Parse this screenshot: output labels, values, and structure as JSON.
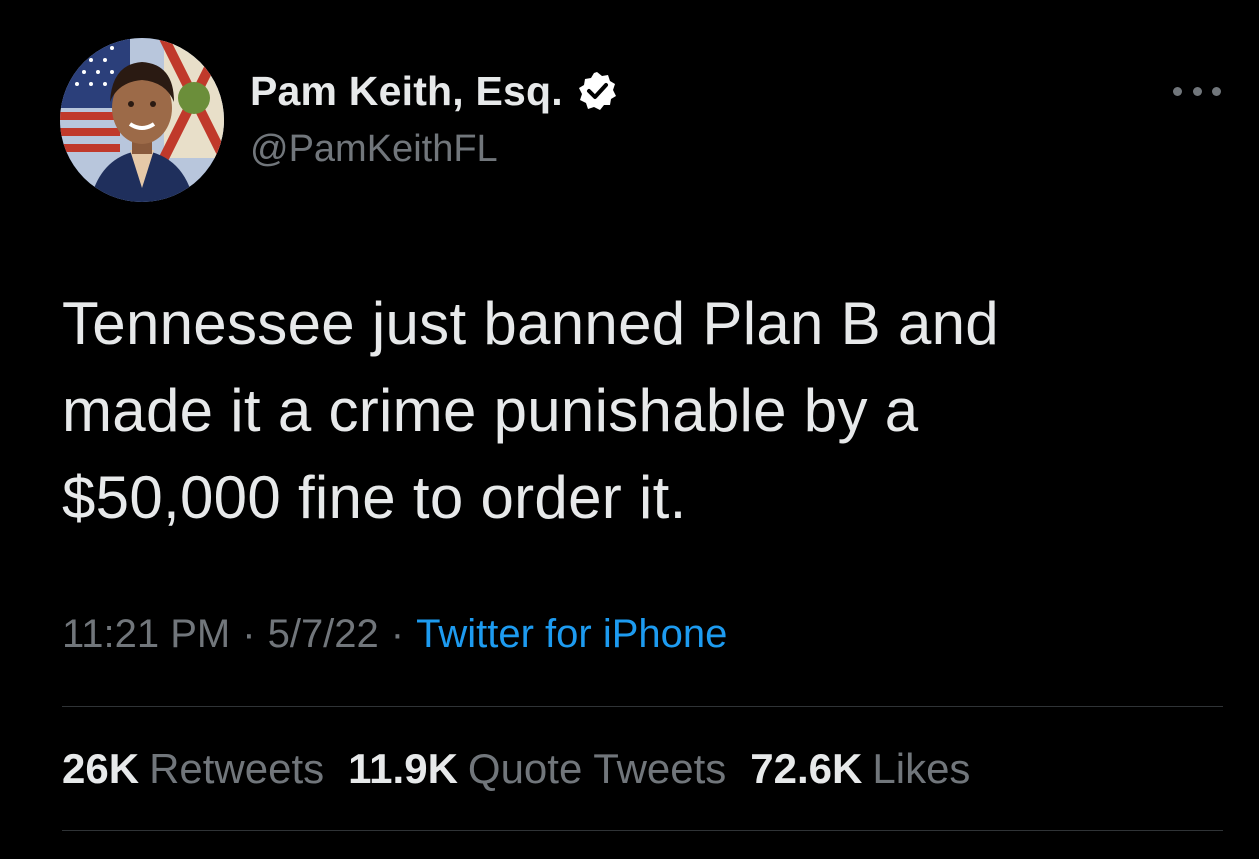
{
  "author": {
    "display_name": "Pam Keith, Esq.",
    "handle": "@PamKeithFL",
    "verified": true
  },
  "tweet": {
    "text_lines": [
      "Tennessee just banned Plan B and",
      "made it a crime punishable by a",
      "$50,000 fine to order it."
    ],
    "time": "11:21 PM",
    "separator": "·",
    "date": "5/7/22",
    "source": "Twitter for iPhone"
  },
  "stats": {
    "retweets": {
      "count": "26K",
      "label": "Retweets"
    },
    "quote_tweets": {
      "count": "11.9K",
      "label": "Quote Tweets"
    },
    "likes": {
      "count": "72.6K",
      "label": "Likes"
    }
  },
  "icons": {
    "verified": "verified-badge-icon",
    "more": "more-options-icon"
  },
  "colors": {
    "background": "#000000",
    "primary_text": "#e7e9ea",
    "secondary_text": "#71767b",
    "link": "#1d9bf0",
    "divider": "#2f3336"
  }
}
